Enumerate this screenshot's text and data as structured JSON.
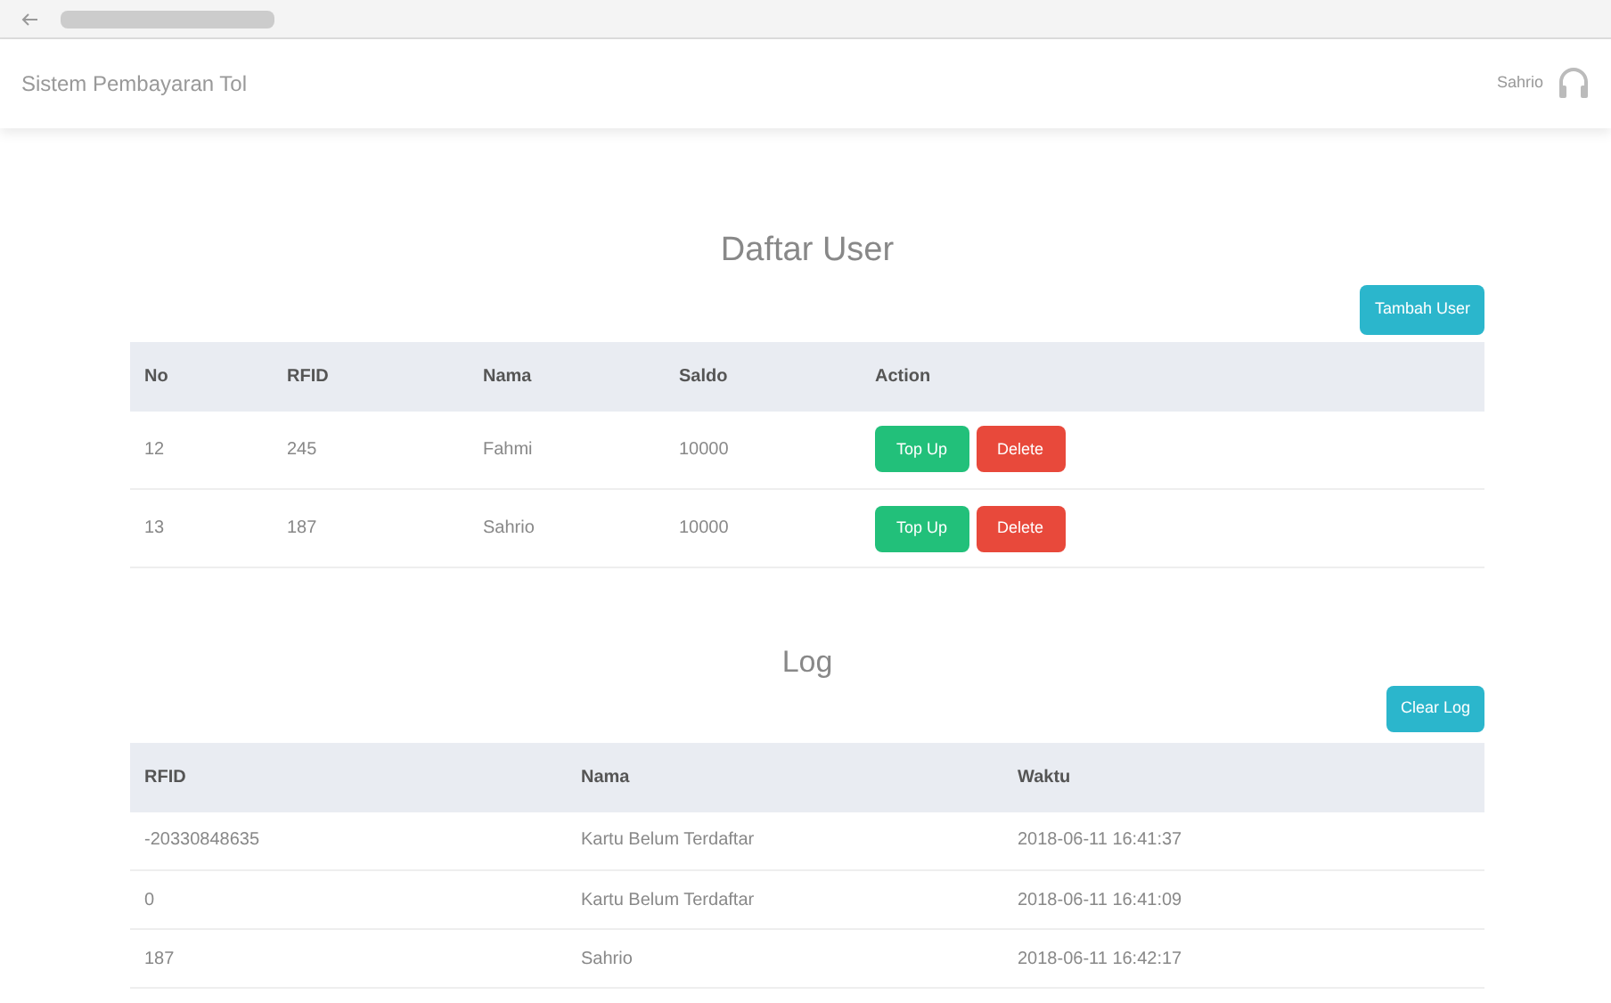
{
  "navbar": {
    "brand": "Sistem Pembayaran Tol",
    "user": "Sahrio"
  },
  "users": {
    "title": "Daftar User",
    "add_button": "Tambah User",
    "columns": [
      "No",
      "RFID",
      "Nama",
      "Saldo",
      "Action"
    ],
    "rows": [
      {
        "no": "12",
        "rfid": "245",
        "nama": "Fahmi",
        "saldo": "10000",
        "actions": [
          "Top Up",
          "Delete"
        ]
      },
      {
        "no": "13",
        "rfid": "187",
        "nama": "Sahrio",
        "saldo": "10000",
        "actions": [
          "Top Up",
          "Delete"
        ]
      }
    ]
  },
  "log": {
    "title": "Log",
    "clear_button": "Clear Log",
    "columns": [
      "RFID",
      "Nama",
      "Waktu"
    ],
    "rows": [
      {
        "rfid": "-20330848635",
        "nama": "Kartu Belum Terdaftar",
        "waktu": "2018-06-11 16:41:37"
      },
      {
        "rfid": "0",
        "nama": "Kartu Belum Terdaftar",
        "waktu": "2018-06-11 16:41:09"
      },
      {
        "rfid": "187",
        "nama": "Sahrio",
        "waktu": "2018-06-11 16:42:17"
      }
    ]
  }
}
